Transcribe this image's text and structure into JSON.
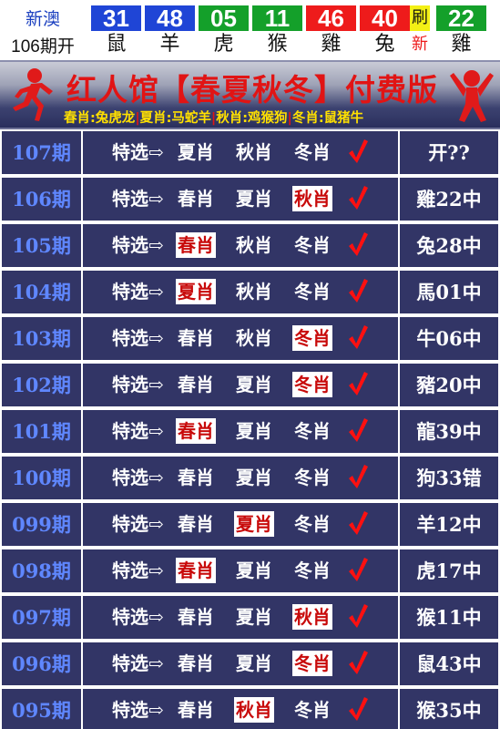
{
  "header": {
    "lottery_name": "新澳",
    "draw_label": "106期开",
    "balls": [
      {
        "num": "31",
        "zodiac": "鼠",
        "color": "blue"
      },
      {
        "num": "48",
        "zodiac": "羊",
        "color": "blue"
      },
      {
        "num": "05",
        "zodiac": "虎",
        "color": "green"
      },
      {
        "num": "11",
        "zodiac": "猴",
        "color": "green"
      },
      {
        "num": "46",
        "zodiac": "雞",
        "color": "red"
      },
      {
        "num": "40",
        "zodiac": "兔",
        "color": "red"
      }
    ],
    "refresh_top": "刷",
    "refresh_bottom": "新",
    "special_ball": {
      "num": "22",
      "zodiac": "雞",
      "color": "green"
    }
  },
  "banner": {
    "title": "红人馆【春夏秋冬】付费版",
    "seasons": [
      {
        "label": "春肖:兔虎龙"
      },
      {
        "label": "夏肖:马蛇羊"
      },
      {
        "label": "秋肖:鸡猴狗"
      },
      {
        "label": "冬肖:鼠猪牛"
      }
    ],
    "separator": "|"
  },
  "colors": {
    "ball_blue": "#1f45d6",
    "ball_green": "#14a02a",
    "ball_red": "#ee1b1b",
    "cell_bg": "#323566",
    "issue_text": "#5f87ff",
    "hit_text": "#c80a0a",
    "check": "#ff1010"
  },
  "table": {
    "pick_label": "特选⇨",
    "check_icon": "red-check-icon",
    "rows": [
      {
        "issue": "107期",
        "picks": [
          "夏肖",
          "秋肖",
          "冬肖"
        ],
        "hit": -1,
        "result": "开??"
      },
      {
        "issue": "106期",
        "picks": [
          "春肖",
          "夏肖",
          "秋肖"
        ],
        "hit": 2,
        "result": "雞22中"
      },
      {
        "issue": "105期",
        "picks": [
          "春肖",
          "秋肖",
          "冬肖"
        ],
        "hit": 0,
        "result": "兔28中"
      },
      {
        "issue": "104期",
        "picks": [
          "夏肖",
          "秋肖",
          "冬肖"
        ],
        "hit": 0,
        "result": "馬01中"
      },
      {
        "issue": "103期",
        "picks": [
          "春肖",
          "秋肖",
          "冬肖"
        ],
        "hit": 2,
        "result": "牛06中"
      },
      {
        "issue": "102期",
        "picks": [
          "春肖",
          "夏肖",
          "冬肖"
        ],
        "hit": 2,
        "result": "豬20中"
      },
      {
        "issue": "101期",
        "picks": [
          "春肖",
          "夏肖",
          "冬肖"
        ],
        "hit": 0,
        "result": "龍39中"
      },
      {
        "issue": "100期",
        "picks": [
          "春肖",
          "夏肖",
          "冬肖"
        ],
        "hit": -1,
        "result": "狗33错"
      },
      {
        "issue": "099期",
        "picks": [
          "春肖",
          "夏肖",
          "冬肖"
        ],
        "hit": 1,
        "result": "羊12中"
      },
      {
        "issue": "098期",
        "picks": [
          "春肖",
          "夏肖",
          "冬肖"
        ],
        "hit": 0,
        "result": "虎17中"
      },
      {
        "issue": "097期",
        "picks": [
          "春肖",
          "夏肖",
          "秋肖"
        ],
        "hit": 2,
        "result": "猴11中"
      },
      {
        "issue": "096期",
        "picks": [
          "春肖",
          "夏肖",
          "冬肖"
        ],
        "hit": 2,
        "result": "鼠43中"
      },
      {
        "issue": "095期",
        "picks": [
          "春肖",
          "秋肖",
          "冬肖"
        ],
        "hit": 1,
        "result": "猴35中"
      }
    ]
  }
}
